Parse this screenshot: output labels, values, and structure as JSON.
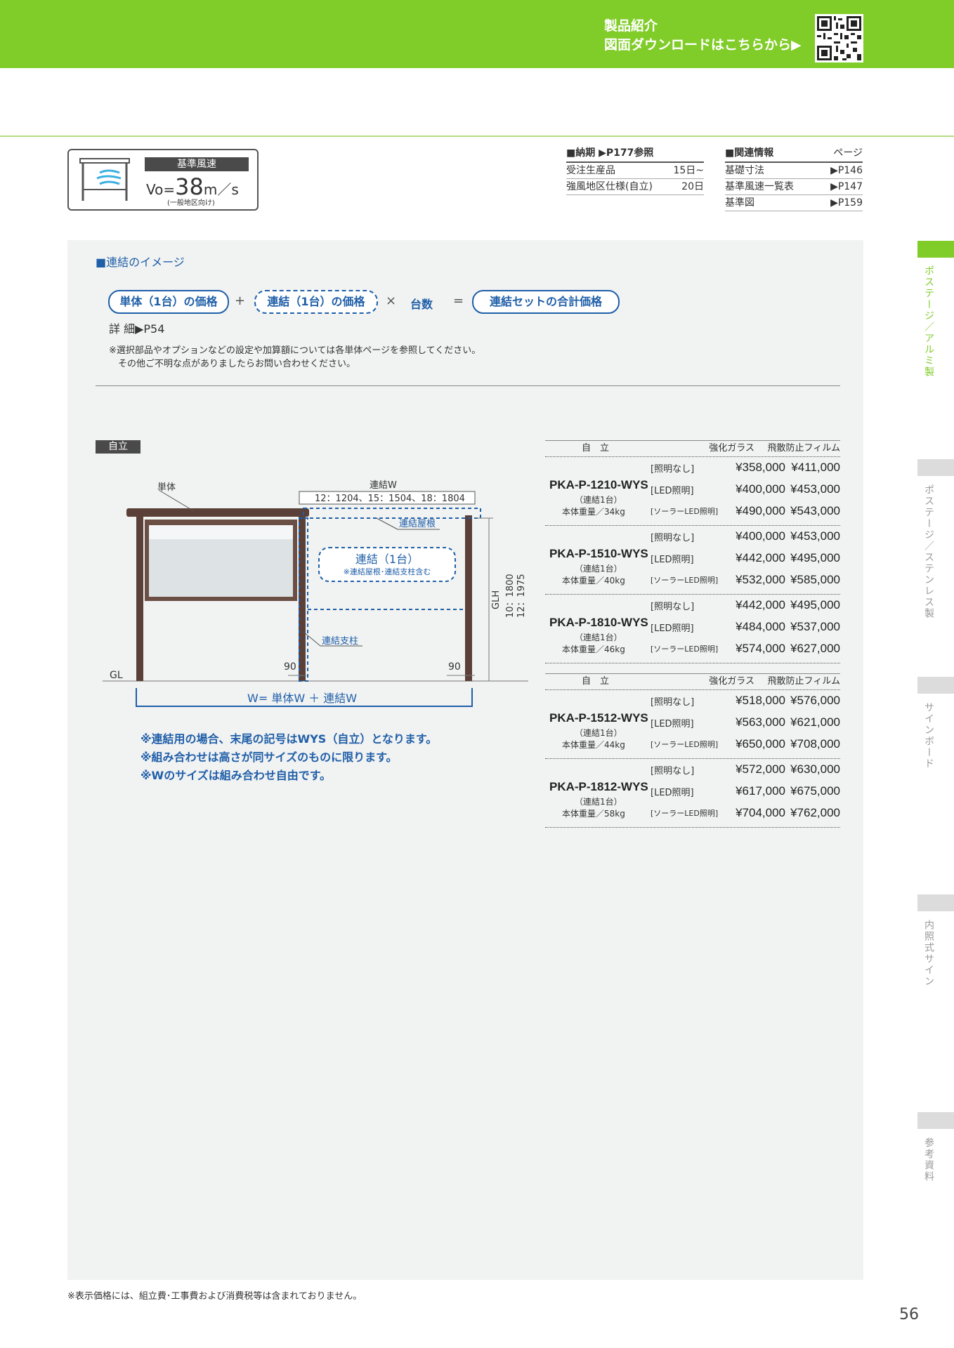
{
  "header": {
    "line1": "製品紹介",
    "line2": "図面ダウンロードはこちらから▶"
  },
  "wind": {
    "title": "基準風速",
    "prefix": "Vo=",
    "value": "38",
    "unit": "m／s",
    "sub": "(一般地区向け)"
  },
  "delivery": {
    "title": "■納期 ▶P177参照",
    "rows": [
      {
        "label": "受注生産品",
        "value": "15日~"
      },
      {
        "label": "強風地区仕様(自立)",
        "value": "20日"
      }
    ]
  },
  "related": {
    "title": "■関連情報",
    "page_label": "ページ",
    "rows": [
      {
        "label": "基礎寸法",
        "value": "▶P146"
      },
      {
        "label": "基準風速一覧表",
        "value": "▶P147"
      },
      {
        "label": "基準図",
        "value": "▶P159"
      }
    ]
  },
  "section_title": "■連結のイメージ",
  "formula": {
    "single": "単体（1台）の価格",
    "plus": "+",
    "link": "連結（1台）の価格",
    "times": "×",
    "count": "台数",
    "equals": "=",
    "total": "連結セットの合計価格"
  },
  "detail": "詳 細▶P54",
  "notes": [
    "※選択部品やオプションなどの設定や加算額については各単体ページを参照してください。",
    "その他ご不明な点がありましたらお問い合わせください。"
  ],
  "tag": "自立",
  "diagram": {
    "single": "単体",
    "link_w": "連結W",
    "link_w_values": "12：1204、15：1504、18：1804",
    "roof": "連結屋根",
    "link_unit": "連結（1台）",
    "link_unit_sub": "※連結屋根･連結支柱含む",
    "post": "連結支柱",
    "gl": "GL",
    "glh": "GLH",
    "h1": "10：1800",
    "h2": "12：1975",
    "dim90a": "90",
    "dim90b": "90",
    "w_formula": "W= 単体W ＋ 連結W"
  },
  "bottom_notes": [
    "※連結用の場合、末尾の記号はWYS（自立）となります。",
    "※組み合わせは高さが同サイズのものに限ります。",
    "※Wのサイズは組み合わせ自由です。"
  ],
  "price_tables": [
    {
      "head": {
        "type": "自　立",
        "glass": "強化ガラス",
        "film": "飛散防止フィルム"
      },
      "groups": [
        {
          "model": "PKA-P-1210-WYS",
          "sub": "（連結1台）",
          "weight": "本体重量／34kg",
          "rows": [
            {
              "label": "[照明なし]",
              "glass": "¥358,000",
              "film": "¥411,000"
            },
            {
              "label": "[LED照明]",
              "glass": "¥400,000",
              "film": "¥453,000"
            },
            {
              "label": "[ソーラーLED照明]",
              "glass": "¥490,000",
              "film": "¥543,000"
            }
          ]
        },
        {
          "model": "PKA-P-1510-WYS",
          "sub": "（連結1台）",
          "weight": "本体重量／40kg",
          "rows": [
            {
              "label": "[照明なし]",
              "glass": "¥400,000",
              "film": "¥453,000"
            },
            {
              "label": "[LED照明]",
              "glass": "¥442,000",
              "film": "¥495,000"
            },
            {
              "label": "[ソーラーLED照明]",
              "glass": "¥532,000",
              "film": "¥585,000"
            }
          ]
        },
        {
          "model": "PKA-P-1810-WYS",
          "sub": "（連結1台）",
          "weight": "本体重量／46kg",
          "rows": [
            {
              "label": "[照明なし]",
              "glass": "¥442,000",
              "film": "¥495,000"
            },
            {
              "label": "[LED照明]",
              "glass": "¥484,000",
              "film": "¥537,000"
            },
            {
              "label": "[ソーラーLED照明]",
              "glass": "¥574,000",
              "film": "¥627,000"
            }
          ]
        }
      ]
    },
    {
      "head": {
        "type": "自　立",
        "glass": "強化ガラス",
        "film": "飛散防止フィルム"
      },
      "groups": [
        {
          "model": "PKA-P-1512-WYS",
          "sub": "（連結1台）",
          "weight": "本体重量／44kg",
          "rows": [
            {
              "label": "[照明なし]",
              "glass": "¥518,000",
              "film": "¥576,000"
            },
            {
              "label": "[LED照明]",
              "glass": "¥563,000",
              "film": "¥621,000"
            },
            {
              "label": "[ソーラーLED照明]",
              "glass": "¥650,000",
              "film": "¥708,000"
            }
          ]
        },
        {
          "model": "PKA-P-1812-WYS",
          "sub": "（連結1台）",
          "weight": "本体重量／58kg",
          "rows": [
            {
              "label": "[照明なし]",
              "glass": "¥572,000",
              "film": "¥630,000"
            },
            {
              "label": "[LED照明]",
              "glass": "¥617,000",
              "film": "¥675,000"
            },
            {
              "label": "[ソーラーLED照明]",
              "glass": "¥704,000",
              "film": "¥762,000"
            }
          ]
        }
      ]
    }
  ],
  "side_tabs": [
    "ポステージ／アルミ製",
    "ポステージ／ステンレス製",
    "サインボード",
    "内照式サイン",
    "参考資料"
  ],
  "footnote": "※表示価格には、組立費･工事費および消費税等は含まれておりません。",
  "page_number": "56",
  "colors": {
    "green": "#80cc28",
    "blue": "#1f5fa8",
    "brown": "#5a4038"
  }
}
